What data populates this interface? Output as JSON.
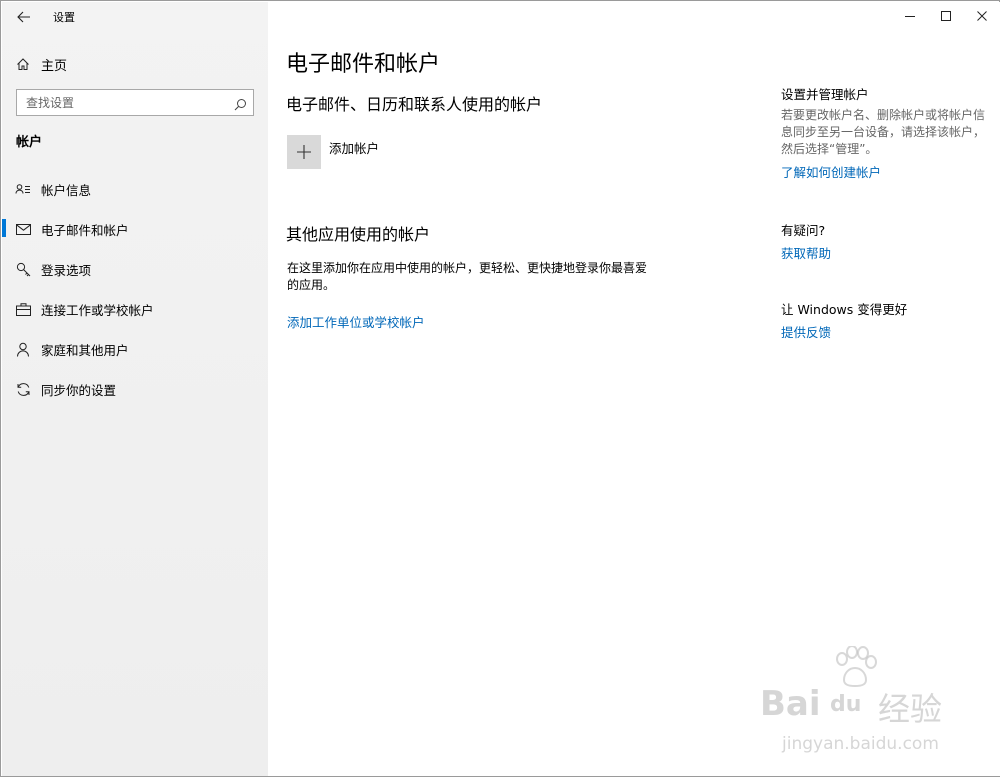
{
  "titlebar": {
    "app_title": "设置"
  },
  "sidebar": {
    "home_label": "主页",
    "search_placeholder": "查找设置",
    "section_label": "帐户",
    "items": [
      {
        "label": "帐户信息",
        "icon": "person-card-icon",
        "active": false
      },
      {
        "label": "电子邮件和帐户",
        "icon": "mail-icon",
        "active": true
      },
      {
        "label": "登录选项",
        "icon": "key-icon",
        "active": false
      },
      {
        "label": "连接工作或学校帐户",
        "icon": "briefcase-icon",
        "active": false
      },
      {
        "label": "家庭和其他用户",
        "icon": "person-icon",
        "active": false
      },
      {
        "label": "同步你的设置",
        "icon": "sync-icon",
        "active": false
      }
    ]
  },
  "main": {
    "page_title": "电子邮件和帐户",
    "section1_heading": "电子邮件、日历和联系人使用的帐户",
    "add_account_label": "添加帐户",
    "section2_heading": "其他应用使用的帐户",
    "section2_text": "在这里添加你在应用中使用的帐户，更轻松、更快捷地登录你最喜爱的应用。",
    "add_work_link": "添加工作单位或学校帐户"
  },
  "right": {
    "manage_title": "设置并管理帐户",
    "manage_text": "若要更改帐户名、删除帐户或将帐户信息同步至另一台设备，请选择该帐户，然后选择“管理”。",
    "manage_link": "了解如何创建帐户",
    "help_title": "有疑问?",
    "help_link": "获取帮助",
    "feedback_title": "让 Windows 变得更好",
    "feedback_link": "提供反馈"
  },
  "watermark": {
    "brand": "Bai",
    "brand2": "du",
    "cn": "经验",
    "url": "jingyan.baidu.com"
  },
  "colors": {
    "accent": "#0078d7",
    "link": "#0067b8",
    "sidebar_bg": "#f2f2f2"
  }
}
